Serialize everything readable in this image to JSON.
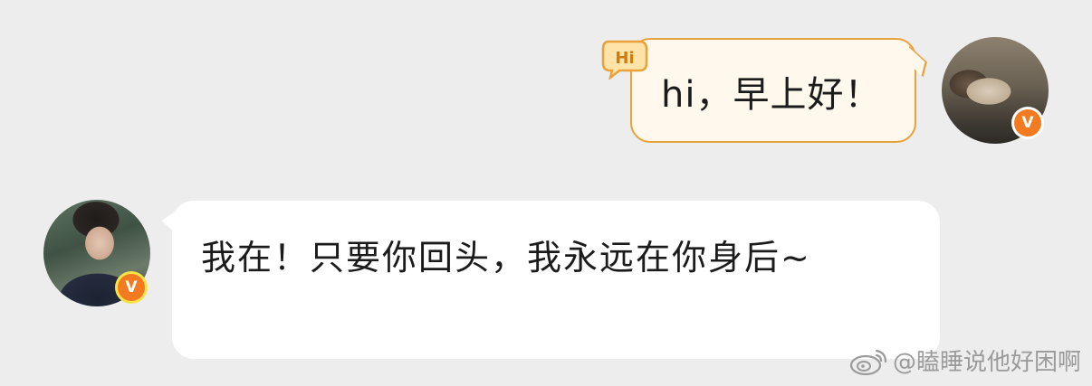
{
  "messages": [
    {
      "side": "right",
      "text": "hi，早上好！",
      "sticker": "Hi"
    },
    {
      "side": "left",
      "text": "我在！只要你回头，我永远在你身后~"
    }
  ],
  "badges": {
    "vip": "V"
  },
  "watermark": {
    "text": "@瞌睡说他好困啊",
    "icon": "weibo-icon"
  },
  "colors": {
    "background": "#ededed",
    "right_bubble": "#fff8ec",
    "right_border": "#e9a23b",
    "left_bubble": "#ffffff",
    "badge": "#f47a20"
  }
}
